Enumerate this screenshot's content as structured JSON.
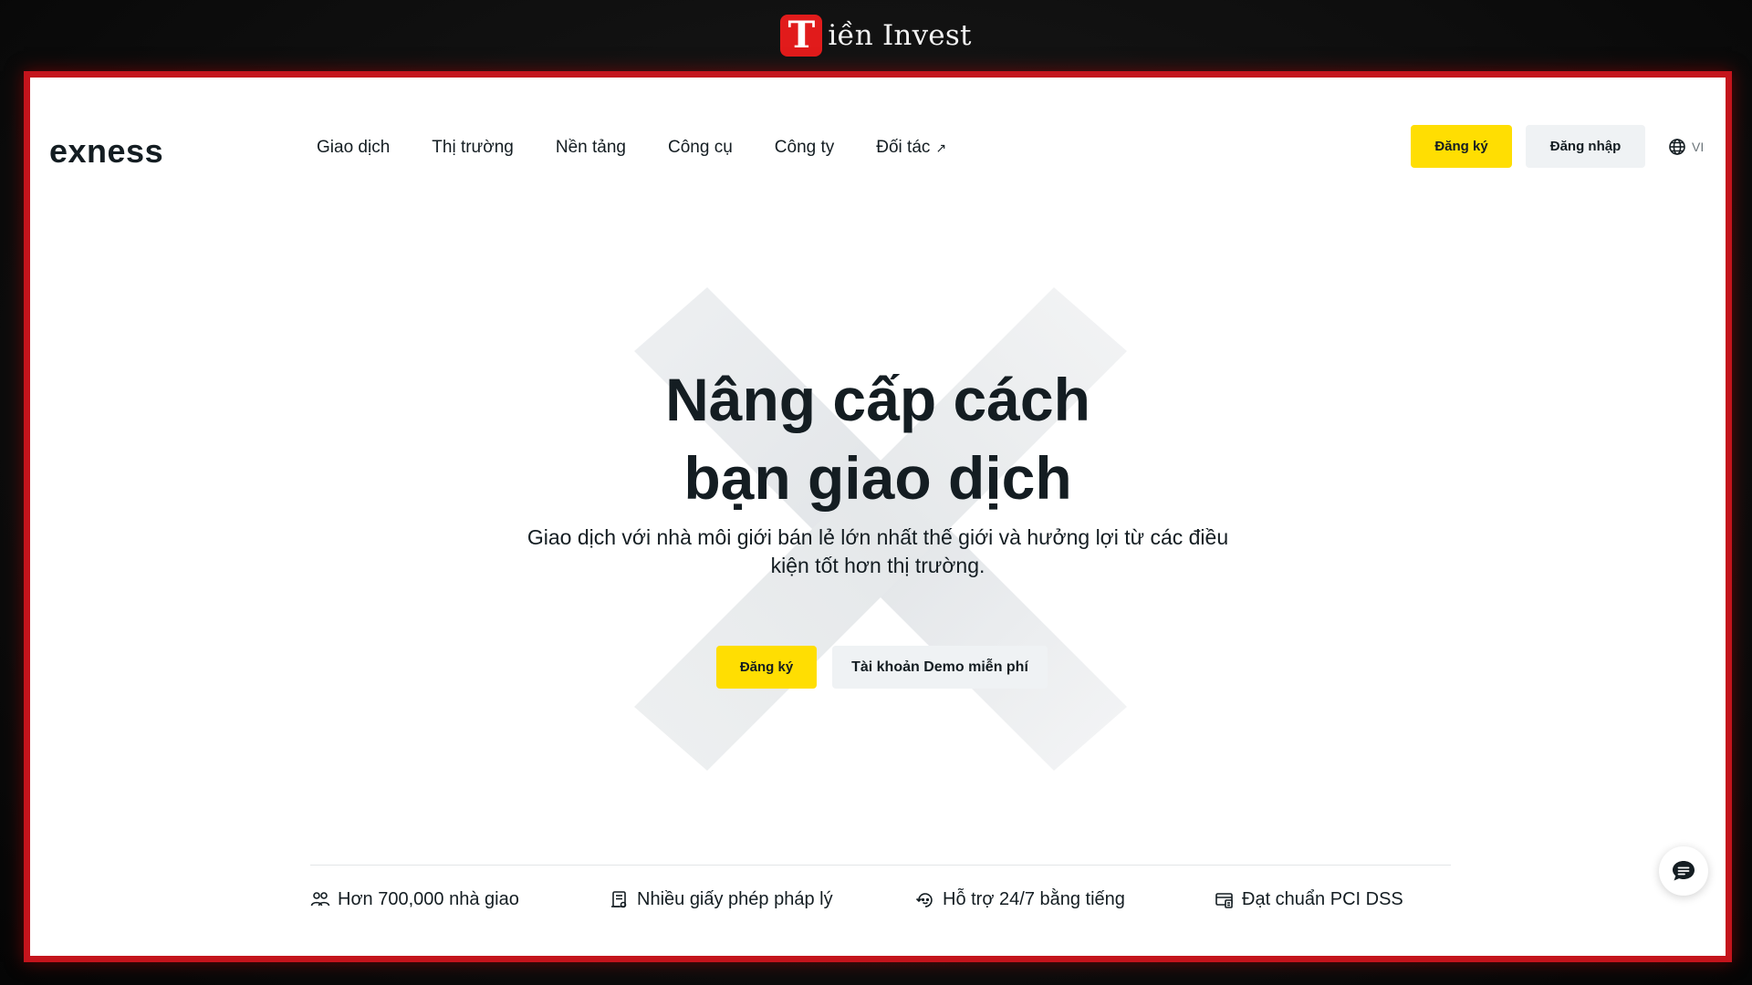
{
  "brand": {
    "mark": "T",
    "text": "iền Invest"
  },
  "header": {
    "logo": "exness",
    "nav": [
      {
        "label": "Giao dịch"
      },
      {
        "label": "Thị trường"
      },
      {
        "label": "Nền tảng"
      },
      {
        "label": "Công cụ"
      },
      {
        "label": "Công ty"
      },
      {
        "label": "Đối tác",
        "arrow": "↗"
      }
    ],
    "signup_label": "Đăng ký",
    "login_label": "Đăng nhập",
    "language": "VI"
  },
  "hero": {
    "title_line1": "Nâng cấp cách",
    "title_line2": "bạn giao dịch",
    "subtitle": "Giao dịch với nhà môi giới bán lẻ lớn nhất thế giới và hưởng lợi từ các điều kiện tốt hơn thị trường.",
    "signup_label": "Đăng ký",
    "demo_label": "Tài khoản Demo miễn phí"
  },
  "features": [
    {
      "icon": "users-icon",
      "label": "Hơn 700,000 nhà giao"
    },
    {
      "icon": "license-icon",
      "label": "Nhiều giấy phép pháp lý"
    },
    {
      "icon": "support-icon",
      "label": "Hỗ trợ 24/7 bằng tiếng"
    },
    {
      "icon": "card-security-icon",
      "label": "Đạt chuẩn PCI DSS"
    }
  ],
  "colors": {
    "accent_yellow": "#ffde02",
    "frame_red": "#c4141c",
    "text_dark": "#141d22"
  }
}
